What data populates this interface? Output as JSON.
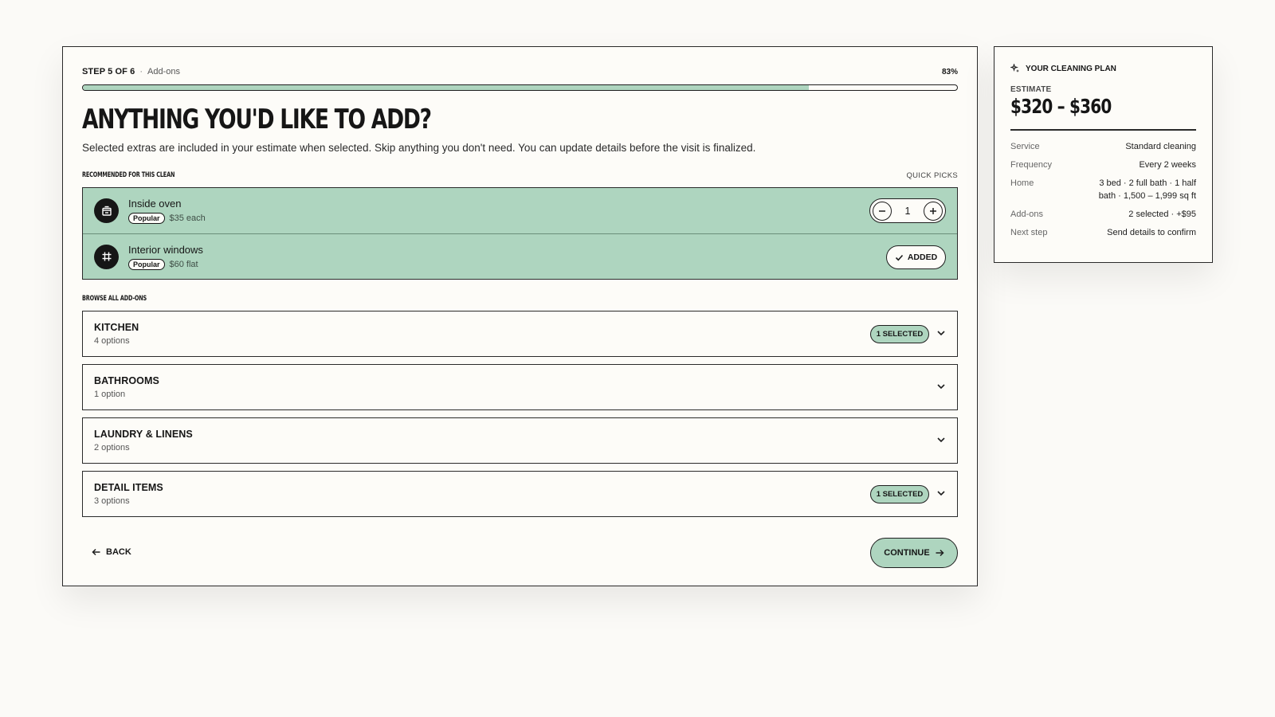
{
  "progress": {
    "step_label": "STEP 5 OF 6",
    "step_name": "Add-ons",
    "percent_label": "83%",
    "percent_value": 0.83
  },
  "heading": "ANYTHING YOU'D LIKE TO ADD?",
  "intro": "Selected extras are included in your estimate when selected. Skip anything you don't need. You can update details before the visit is finalized.",
  "recommended": {
    "heading": "RECOMMENDED FOR THIS CLEAN",
    "quick_picks": "QUICK PICKS",
    "items": [
      {
        "name": "Inside oven",
        "badge": "Popular",
        "price": "$35 each",
        "icon": "oven-icon",
        "quantity": "1"
      },
      {
        "name": "Interior windows",
        "badge": "Popular",
        "price": "$60 flat",
        "icon": "window-grid-icon",
        "status": "ADDED"
      }
    ]
  },
  "browse": {
    "heading": "BROWSE ALL ADD-ONS",
    "categories": [
      {
        "name": "KITCHEN",
        "count": "4 options",
        "badge": "1 SELECTED"
      },
      {
        "name": "BATHROOMS",
        "count": "1 option",
        "badge": ""
      },
      {
        "name": "LAUNDRY & LINENS",
        "count": "2 options",
        "badge": ""
      },
      {
        "name": "DETAIL ITEMS",
        "count": "3 options",
        "badge": "1 SELECTED"
      }
    ]
  },
  "footer": {
    "back_label": "BACK",
    "continue_label": "CONTINUE"
  },
  "plan": {
    "title": "YOUR CLEANING PLAN",
    "estimate_label": "ESTIMATE",
    "estimate_value": "$320 – $360",
    "rows": [
      {
        "key": "Service",
        "value": "Standard cleaning"
      },
      {
        "key": "Frequency",
        "value": "Every 2 weeks"
      },
      {
        "key": "Home",
        "value": "3 bed · 2 full bath · 1 half bath · 1,500 – 1,999 sq ft"
      },
      {
        "key": "Add-ons",
        "value": "2 selected · +$95"
      },
      {
        "key": "Next step",
        "value": "Send details to confirm"
      }
    ]
  },
  "colors": {
    "accent": "#aed5bf",
    "background": "#fbfaf7",
    "ink": "#161616"
  }
}
